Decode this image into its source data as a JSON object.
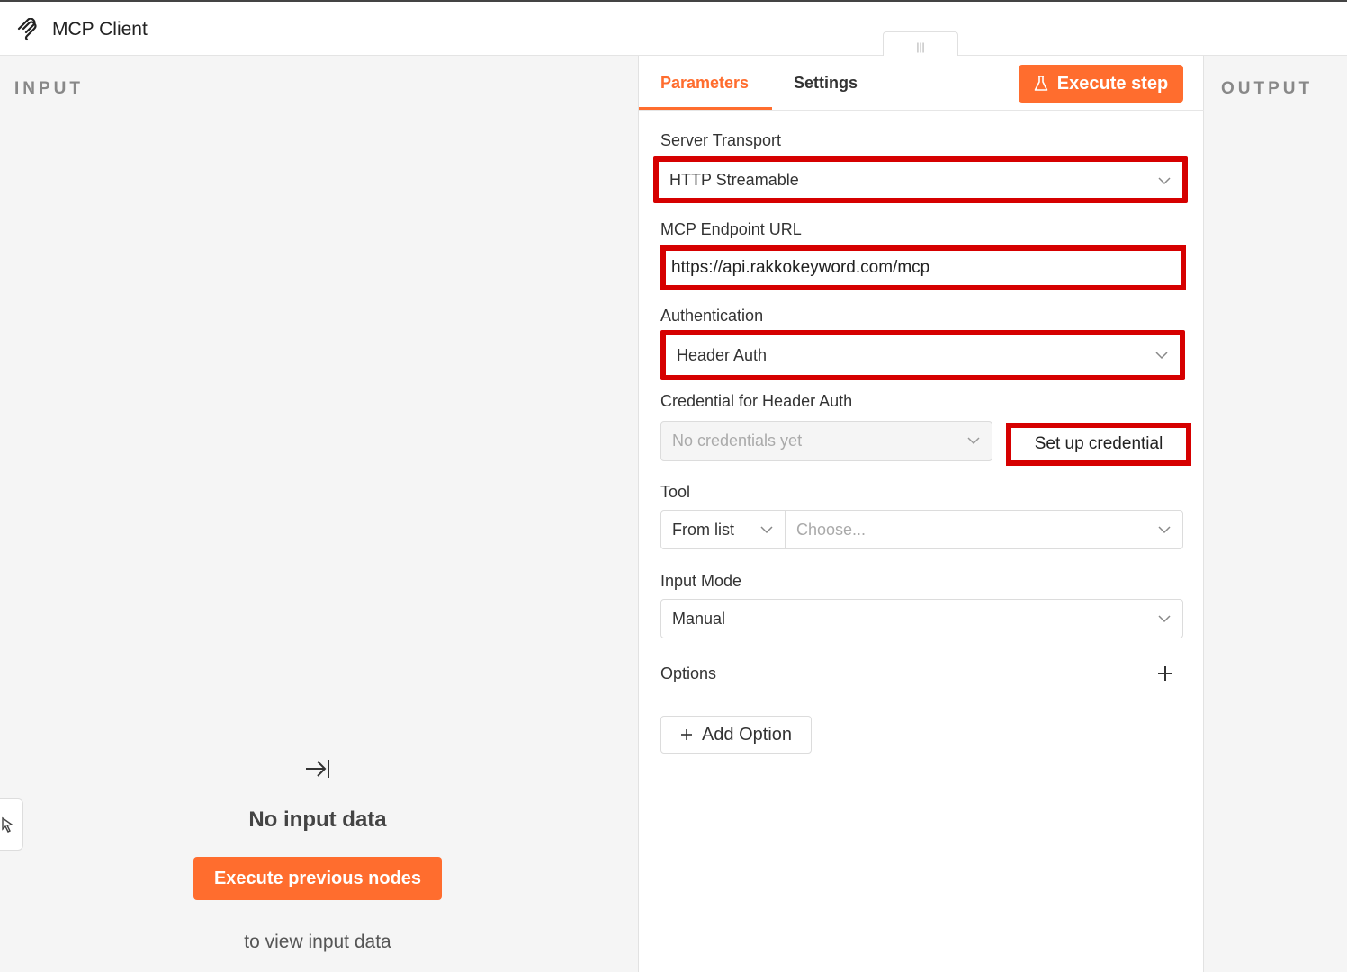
{
  "app": {
    "title": "MCP Client",
    "logo_icon": "mcp-logo-icon",
    "drag_handle": "|||"
  },
  "input_pane": {
    "label": "INPUT",
    "empty_icon": "arrow-to-right-icon",
    "empty_title": "No input data",
    "execute_button": "Execute previous nodes",
    "hint": "to view input data"
  },
  "output_pane": {
    "label": "OUTPUT"
  },
  "tabs": {
    "parameters": "Parameters",
    "settings": "Settings"
  },
  "execute_step": {
    "label": "Execute step",
    "icon": "flask-icon"
  },
  "fields": {
    "server_transport": {
      "label": "Server Transport",
      "value": "HTTP Streamable"
    },
    "endpoint_url": {
      "label": "MCP Endpoint URL",
      "value": "https://api.rakkokeyword.com/mcp"
    },
    "authentication": {
      "label": "Authentication",
      "value": "Header Auth"
    },
    "credential": {
      "label": "Credential for Header Auth",
      "placeholder": "No credentials yet",
      "setup_button": "Set up credential"
    },
    "tool": {
      "label": "Tool",
      "mode": "From list",
      "placeholder": "Choose..."
    },
    "input_mode": {
      "label": "Input Mode",
      "value": "Manual"
    },
    "options": {
      "label": "Options"
    }
  },
  "add_option": {
    "label": "Add Option"
  },
  "colors": {
    "accent": "#ff6d2e",
    "highlight": "#d60000"
  }
}
